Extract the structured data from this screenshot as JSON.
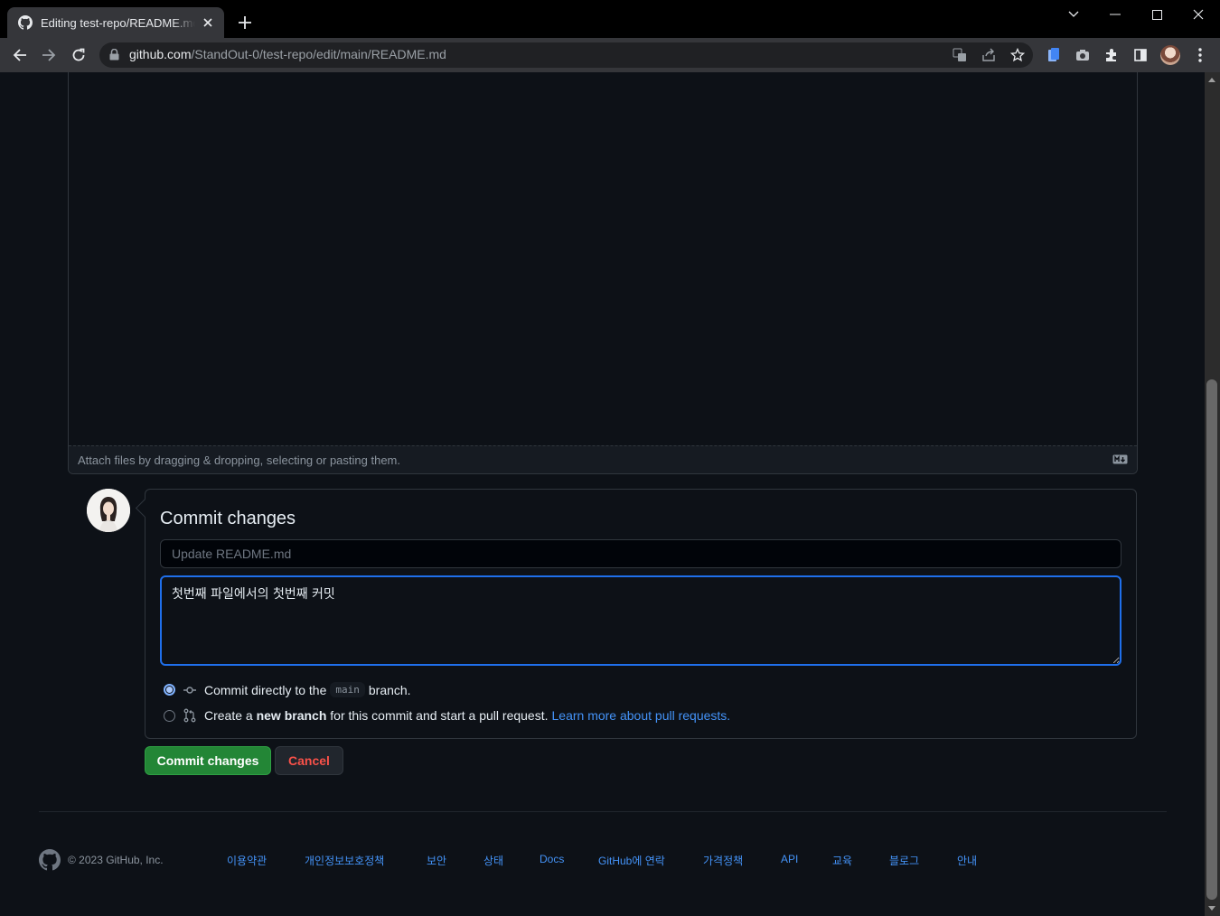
{
  "browser": {
    "tab_title": "Editing test-repo/README.md at main",
    "url_host": "github.com",
    "url_path": "/StandOut-0/test-repo/edit/main/README.md"
  },
  "editor": {
    "attach_hint": "Attach files by dragging & dropping, selecting or pasting them."
  },
  "commit": {
    "title": "Commit changes",
    "summary_placeholder": "Update README.md",
    "description": "첫번째 파일에서의 첫번째 커밋",
    "option_direct": {
      "prefix": "Commit directly to the",
      "branch": "main",
      "suffix": "branch.",
      "selected": true
    },
    "option_new": {
      "prefix": "Create a",
      "bold": "new branch",
      "suffix": "for this commit and start a pull request.",
      "link": "Learn more about pull requests.",
      "selected": false
    },
    "commit_button": "Commit changes",
    "cancel_button": "Cancel"
  },
  "footer": {
    "copyright": "© 2023 GitHub, Inc.",
    "links": [
      "이용약관",
      "개인정보보호정책",
      "보안",
      "상태",
      "Docs",
      "GitHub에 연락",
      "가격정책",
      "API",
      "교육",
      "블로그",
      "안내"
    ]
  },
  "colors": {
    "page_bg": "#0d1117",
    "border": "#30363d",
    "link": "#4493f8",
    "commit_green": "#238636",
    "cancel_red": "#f85149",
    "focus_blue": "#1f6feb"
  },
  "icons": {
    "tab_favicon": "github-octocat-icon",
    "footer_logo": "github-mark-icon",
    "markdown": "markdown-icon",
    "direct_commit": "git-commit-icon",
    "new_branch": "git-pull-request-icon"
  }
}
